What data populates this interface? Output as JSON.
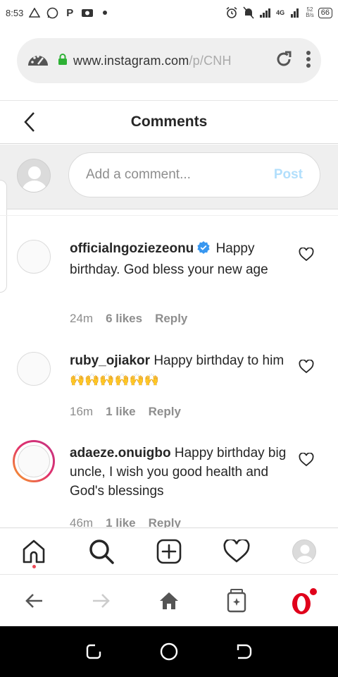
{
  "status_bar": {
    "time": "8:53",
    "network": "4G",
    "net_speed": "52",
    "net_speed_unit": "B/s",
    "battery": "66"
  },
  "browser": {
    "url_host": "www.instagram.com",
    "url_path": "/p/CNH"
  },
  "header": {
    "title": "Comments"
  },
  "comment_box": {
    "placeholder": "Add a comment...",
    "post_label": "Post"
  },
  "comments": [
    {
      "username": "officialngoziezeonu",
      "verified": true,
      "text": "Happy birthday. God bless your new age",
      "time": "24m",
      "likes": "6 likes",
      "reply_label": "Reply"
    },
    {
      "username": "ruby_ojiakor",
      "verified": false,
      "text": "Happy birthday to him",
      "emoji": "🙌🙌🙌🙌🙌🙌",
      "time": "16m",
      "likes": "1 like",
      "reply_label": "Reply"
    },
    {
      "username": "adaeze.onuigbo",
      "verified": false,
      "text": "Happy birthday big uncle, I wish you good health and God's blessings",
      "time": "46m",
      "likes": "1 like",
      "reply_label": "Reply"
    }
  ],
  "colors": {
    "verified_blue": "#3897f0",
    "post_disabled": "#b2dffc",
    "opera_red": "#e0001b",
    "notif_red": "#ed4956"
  },
  "icons": {
    "nav": [
      "home-icon",
      "search-icon",
      "new-post-icon",
      "activity-heart-icon",
      "profile-avatar"
    ],
    "browser": [
      "back-arrow-icon",
      "forward-arrow-icon",
      "home-icon",
      "tabs-icon",
      "opera-icon"
    ]
  }
}
